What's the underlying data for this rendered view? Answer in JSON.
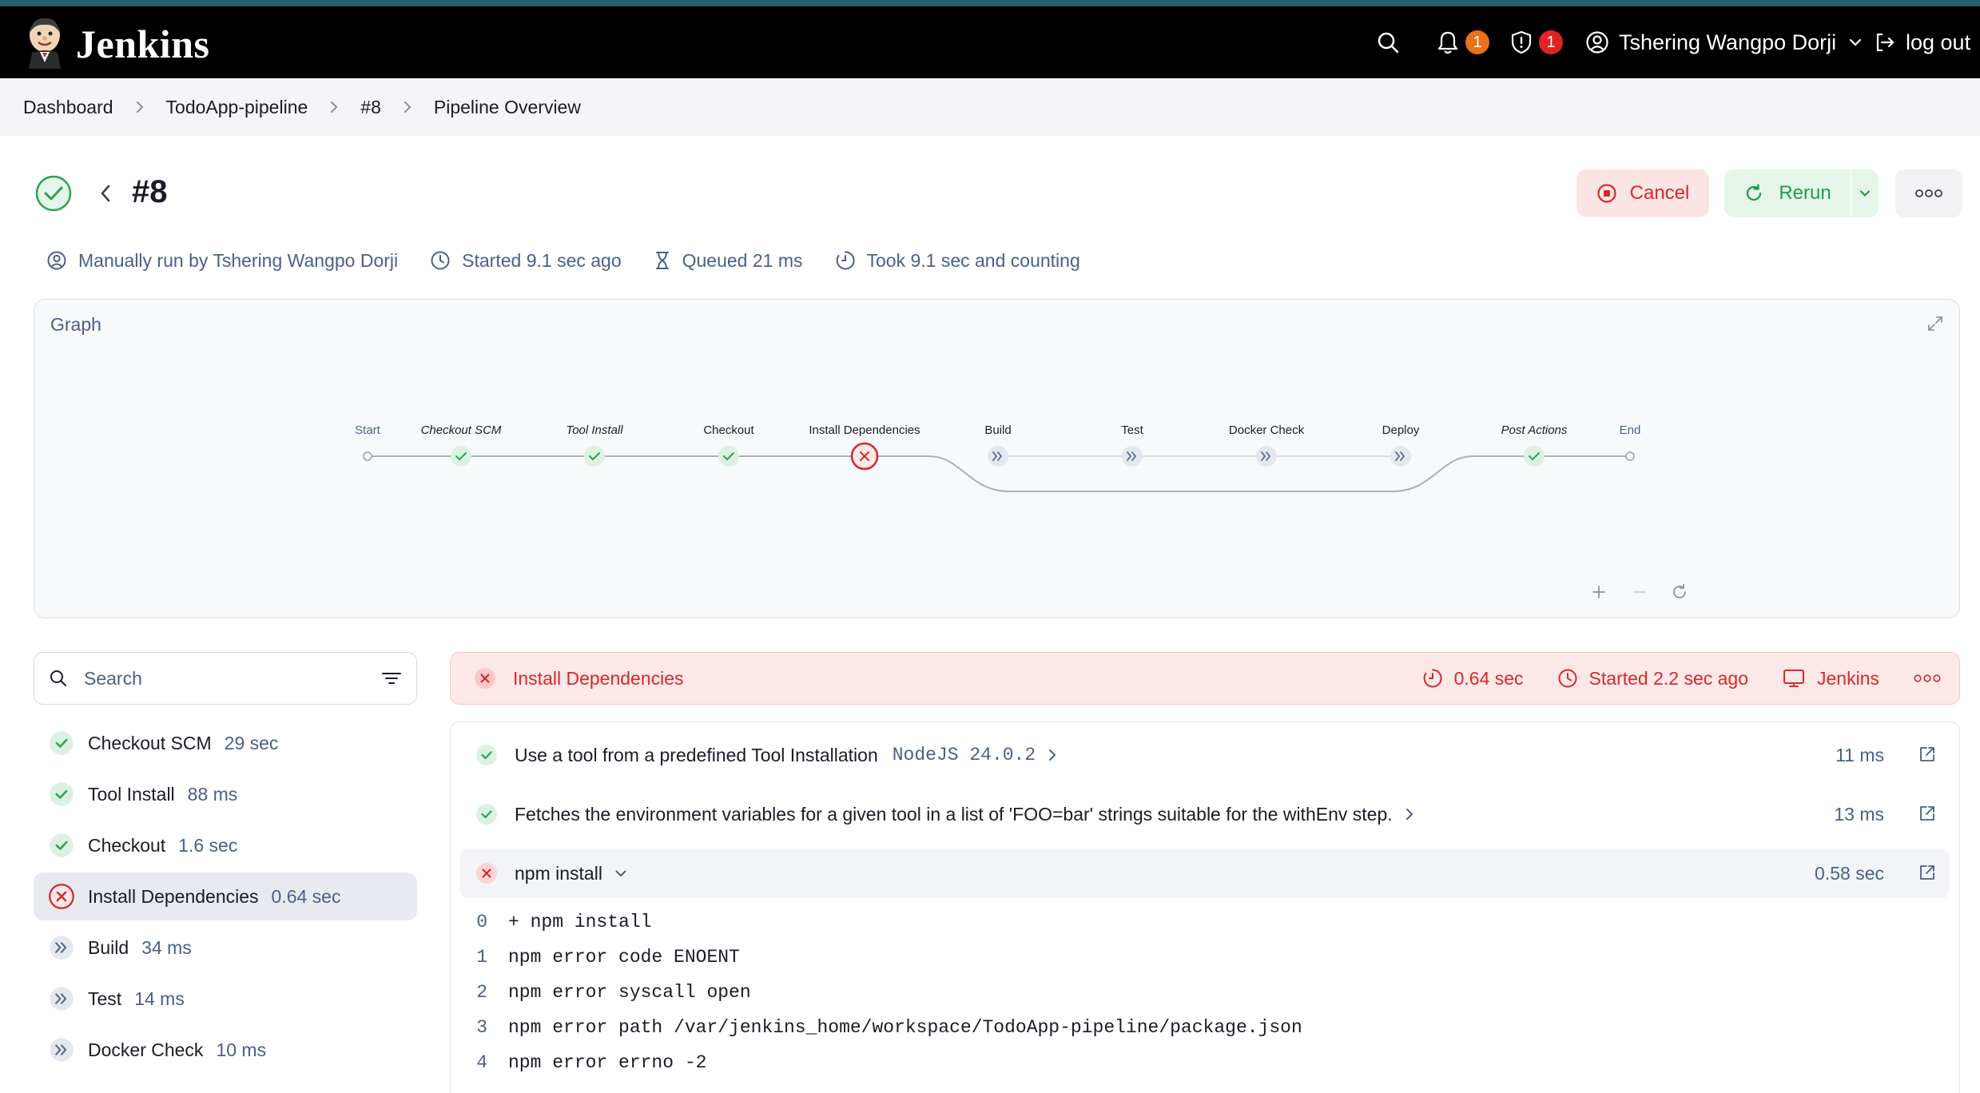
{
  "header": {
    "brand": "Jenkins",
    "notifications_count": "1",
    "security_count": "1",
    "user_name": "Tshering Wangpo Dorji",
    "logout_label": "log out",
    "colors": {
      "bar": "#000000",
      "notif_badge": "#e8711a",
      "security_badge": "#e02424"
    }
  },
  "breadcrumbs": [
    "Dashboard",
    "TodoApp-pipeline",
    "#8",
    "Pipeline Overview"
  ],
  "run": {
    "title": "#8",
    "status": "success",
    "cancel_label": "Cancel",
    "rerun_label": "Rerun",
    "meta": {
      "triggered_by": "Manually run by Tshering Wangpo Dorji",
      "started": "Started 9.1 sec ago",
      "queued": "Queued 21 ms",
      "took": "Took 9.1 sec and counting"
    }
  },
  "graph": {
    "title": "Graph",
    "nodes": [
      {
        "label": "Start",
        "state": "terminal"
      },
      {
        "label": "Checkout SCM",
        "state": "success",
        "italic": true
      },
      {
        "label": "Tool Install",
        "state": "success",
        "italic": true
      },
      {
        "label": "Checkout",
        "state": "success"
      },
      {
        "label": "Install Dependencies",
        "state": "failed"
      },
      {
        "label": "Build",
        "state": "skipped"
      },
      {
        "label": "Test",
        "state": "skipped"
      },
      {
        "label": "Docker Check",
        "state": "skipped"
      },
      {
        "label": "Deploy",
        "state": "skipped"
      },
      {
        "label": "Post Actions",
        "state": "success",
        "italic": true
      },
      {
        "label": "End",
        "state": "terminal"
      }
    ]
  },
  "search": {
    "placeholder": "Search"
  },
  "stages": [
    {
      "name": "Checkout SCM",
      "duration": "29 sec",
      "state": "success"
    },
    {
      "name": "Tool Install",
      "duration": "88 ms",
      "state": "success"
    },
    {
      "name": "Checkout",
      "duration": "1.6 sec",
      "state": "success"
    },
    {
      "name": "Install Dependencies",
      "duration": "0.64 sec",
      "state": "failed"
    },
    {
      "name": "Build",
      "duration": "34 ms",
      "state": "skipped"
    },
    {
      "name": "Test",
      "duration": "14 ms",
      "state": "skipped"
    },
    {
      "name": "Docker Check",
      "duration": "10 ms",
      "state": "skipped"
    }
  ],
  "selected_stage": {
    "name": "Install Dependencies",
    "duration": "0.64 sec",
    "started": "Started 2.2 sec ago",
    "agent": "Jenkins"
  },
  "steps": [
    {
      "text": "Use a tool from a predefined Tool Installation",
      "arg": "NodeJS 24.0.2",
      "duration": "11 ms",
      "state": "success"
    },
    {
      "text": "Fetches the environment variables for a given tool in a list of 'FOO=bar' strings suitable for the withEnv step.",
      "arg": "",
      "duration": "13 ms",
      "state": "success"
    },
    {
      "text": "npm install",
      "arg": "",
      "duration": "0.58 sec",
      "state": "failed"
    }
  ],
  "log": [
    {
      "n": "0",
      "text": "+ npm install"
    },
    {
      "n": "1",
      "text": "npm error code ENOENT"
    },
    {
      "n": "2",
      "text": "npm error syscall open"
    },
    {
      "n": "3",
      "text": "npm error path /var/jenkins_home/workspace/TodoApp-pipeline/package.json"
    },
    {
      "n": "4",
      "text": "npm error errno -2"
    }
  ]
}
